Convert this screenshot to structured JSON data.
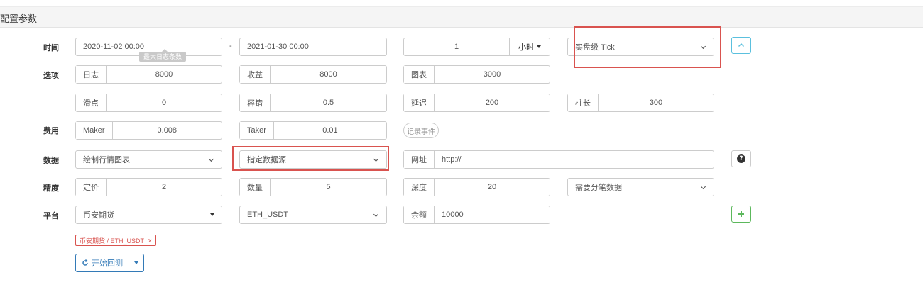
{
  "header": {
    "title": "配置参数"
  },
  "rows": {
    "time": {
      "label": "时间"
    },
    "options": {
      "label": "选项"
    },
    "fees": {
      "label": "费用"
    },
    "data": {
      "label": "数据"
    },
    "precision": {
      "label": "精度"
    },
    "platform": {
      "label": "平台"
    }
  },
  "time": {
    "start": "2020-11-02 00:00",
    "separator": "-",
    "end": "2021-01-30 00:00",
    "period_value": "1",
    "period_unit": "小时",
    "mode": "实盘级 Tick",
    "tooltip": "最大日志条数"
  },
  "options": {
    "log_label": "日志",
    "log_value": "8000",
    "profit_label": "收益",
    "profit_value": "8000",
    "chart_label": "图表",
    "chart_value": "3000",
    "slippage_label": "滑点",
    "slippage_value": "0",
    "tolerance_label": "容错",
    "tolerance_value": "0.5",
    "delay_label": "延迟",
    "delay_value": "200",
    "bar_label": "柱长",
    "bar_value": "300"
  },
  "fees": {
    "maker_label": "Maker",
    "maker_value": "0.008",
    "taker_label": "Taker",
    "taker_value": "0.01",
    "record_events": "记录事件"
  },
  "data": {
    "chart_select": "绘制行情图表",
    "source_select": "指定数据源",
    "url_label": "网址",
    "url_value": "http://"
  },
  "precision": {
    "price_label": "定价",
    "price_value": "2",
    "amount_label": "数量",
    "amount_value": "5",
    "depth_label": "深度",
    "depth_value": "20",
    "tick_select": "需要分笔数据"
  },
  "platform": {
    "exchange_select": "币安期货",
    "pair_select": "ETH_USDT",
    "balance_label": "余额",
    "balance_value": "10000",
    "tag": "币安期货 / ETH_USDT",
    "tag_close": "x"
  },
  "actions": {
    "start_backtest": "开始回测"
  },
  "colors": {
    "red": "#d9534f",
    "accent": "#5bc0de",
    "green": "#5cb85c",
    "blue": "#337ab7"
  }
}
